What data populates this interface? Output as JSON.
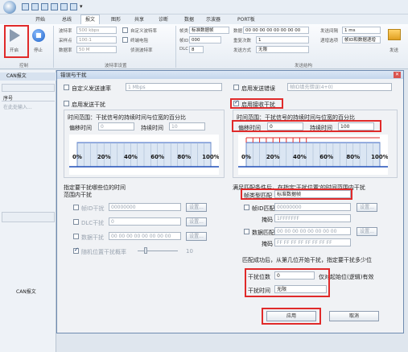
{
  "ribbon": {
    "tabs": [
      "开始",
      "总线",
      "报文",
      "图形",
      "共享",
      "诊断",
      "数据",
      "示波器",
      "PORT板"
    ],
    "active_tab": 2,
    "start_label": "开启",
    "stop_label": "停止",
    "group_control": "控制",
    "group_baud": "波特率设置",
    "group_send": "发送结构",
    "baud_label": "波特率",
    "baud_value": "500 kbps",
    "sample_label": "采样点",
    "sample_value": "100:1",
    "fd_baud_label": "数据率",
    "fd_baud_value": "50 M",
    "custom_label": "自定义波特率",
    "terminal_label": "终端电阻",
    "detect_label": "侦测波特率",
    "frame_label": "帧类",
    "frame_value": "标准数据帧",
    "id_label": "帧ID",
    "id_value": "000",
    "dlc_label": "DLC",
    "dlc_value": "8",
    "data_label": "数据",
    "data_value": "00 00 00 00 00 00 00 00",
    "count_label": "重复次数",
    "count_value": "1",
    "mode_label": "发送方式",
    "mode_value": "无限",
    "period_label": "发送间隔",
    "period_value": "1 ms",
    "inc_label": "递增选项",
    "inc_value": "帧ID和数据递增",
    "send_label": "发送"
  },
  "left": {
    "tab_label": "CAN报文",
    "col_header": "序号",
    "row_text": "在此处输入...",
    "bottom_label": "CAN报文"
  },
  "dialog": {
    "title": "错误与干扰",
    "close": "✕",
    "left": {
      "custom_rate_label": "自定义发送速率",
      "custom_rate_value": "1 Mbps",
      "enable_send_label": "启用发送干扰",
      "range_desc": "时间范围：干扰信号的持续时间与位宽的百分比",
      "offset_label": "偏移时间",
      "offset_value": "0",
      "duration_label": "持续时间",
      "duration_value": "10",
      "bit_desc": "指定要干扰哪些位的时间",
      "bit_desc2": "范围内干扰",
      "id_label": "帧ID干扰",
      "id_value": "00000000",
      "dlc_label": "DLC干扰",
      "dlc_value": "0",
      "data_label": "数据干扰",
      "data_value": "00 00 00 00 00 00 00 00",
      "random_label": "随机位置干扰概率",
      "random_value": "10",
      "set_btn": "设置..."
    },
    "right": {
      "enable_send_nak_label": "启用发送错误",
      "crc_value": "帧ID填充错误(4+0)",
      "enable_recv_label": "启用接收干扰",
      "range_desc": "时间范围：干扰信号的持续时间与位宽的百分比",
      "offset_label": "偏移时间",
      "offset_value": "0",
      "duration_label": "持续时间",
      "duration_value": "100",
      "cond_desc": "满足匹配条件后，在指定'干扰位置'的时间范围内干扰",
      "type_label": "帧类型匹配",
      "type_value": "标准数据帧",
      "id_match_label": "帧ID匹配",
      "id_match_value": "00000000",
      "mask_label": "掩码",
      "mask_value": "1FFFFFFF",
      "data_match_label": "数据匹配",
      "data_match_value": "00 00 00 00 00 00 00 00",
      "data_mask_value": "FF FF FF FF FF FF FF FF",
      "after_desc": "匹配成功后，从第几位开始干扰，指定要干扰多少位",
      "pos_label": "干扰位数",
      "pos_value": "0",
      "pos_note": "仅对起始位(逻辑)有效",
      "time_label": "干扰时间",
      "time_value": "无限",
      "set_btn": "设置..."
    },
    "apply": "应用",
    "cancel": "取消"
  },
  "chart_ticks": [
    "0%",
    "20%",
    "40%",
    "60%",
    "80%",
    "100%"
  ]
}
